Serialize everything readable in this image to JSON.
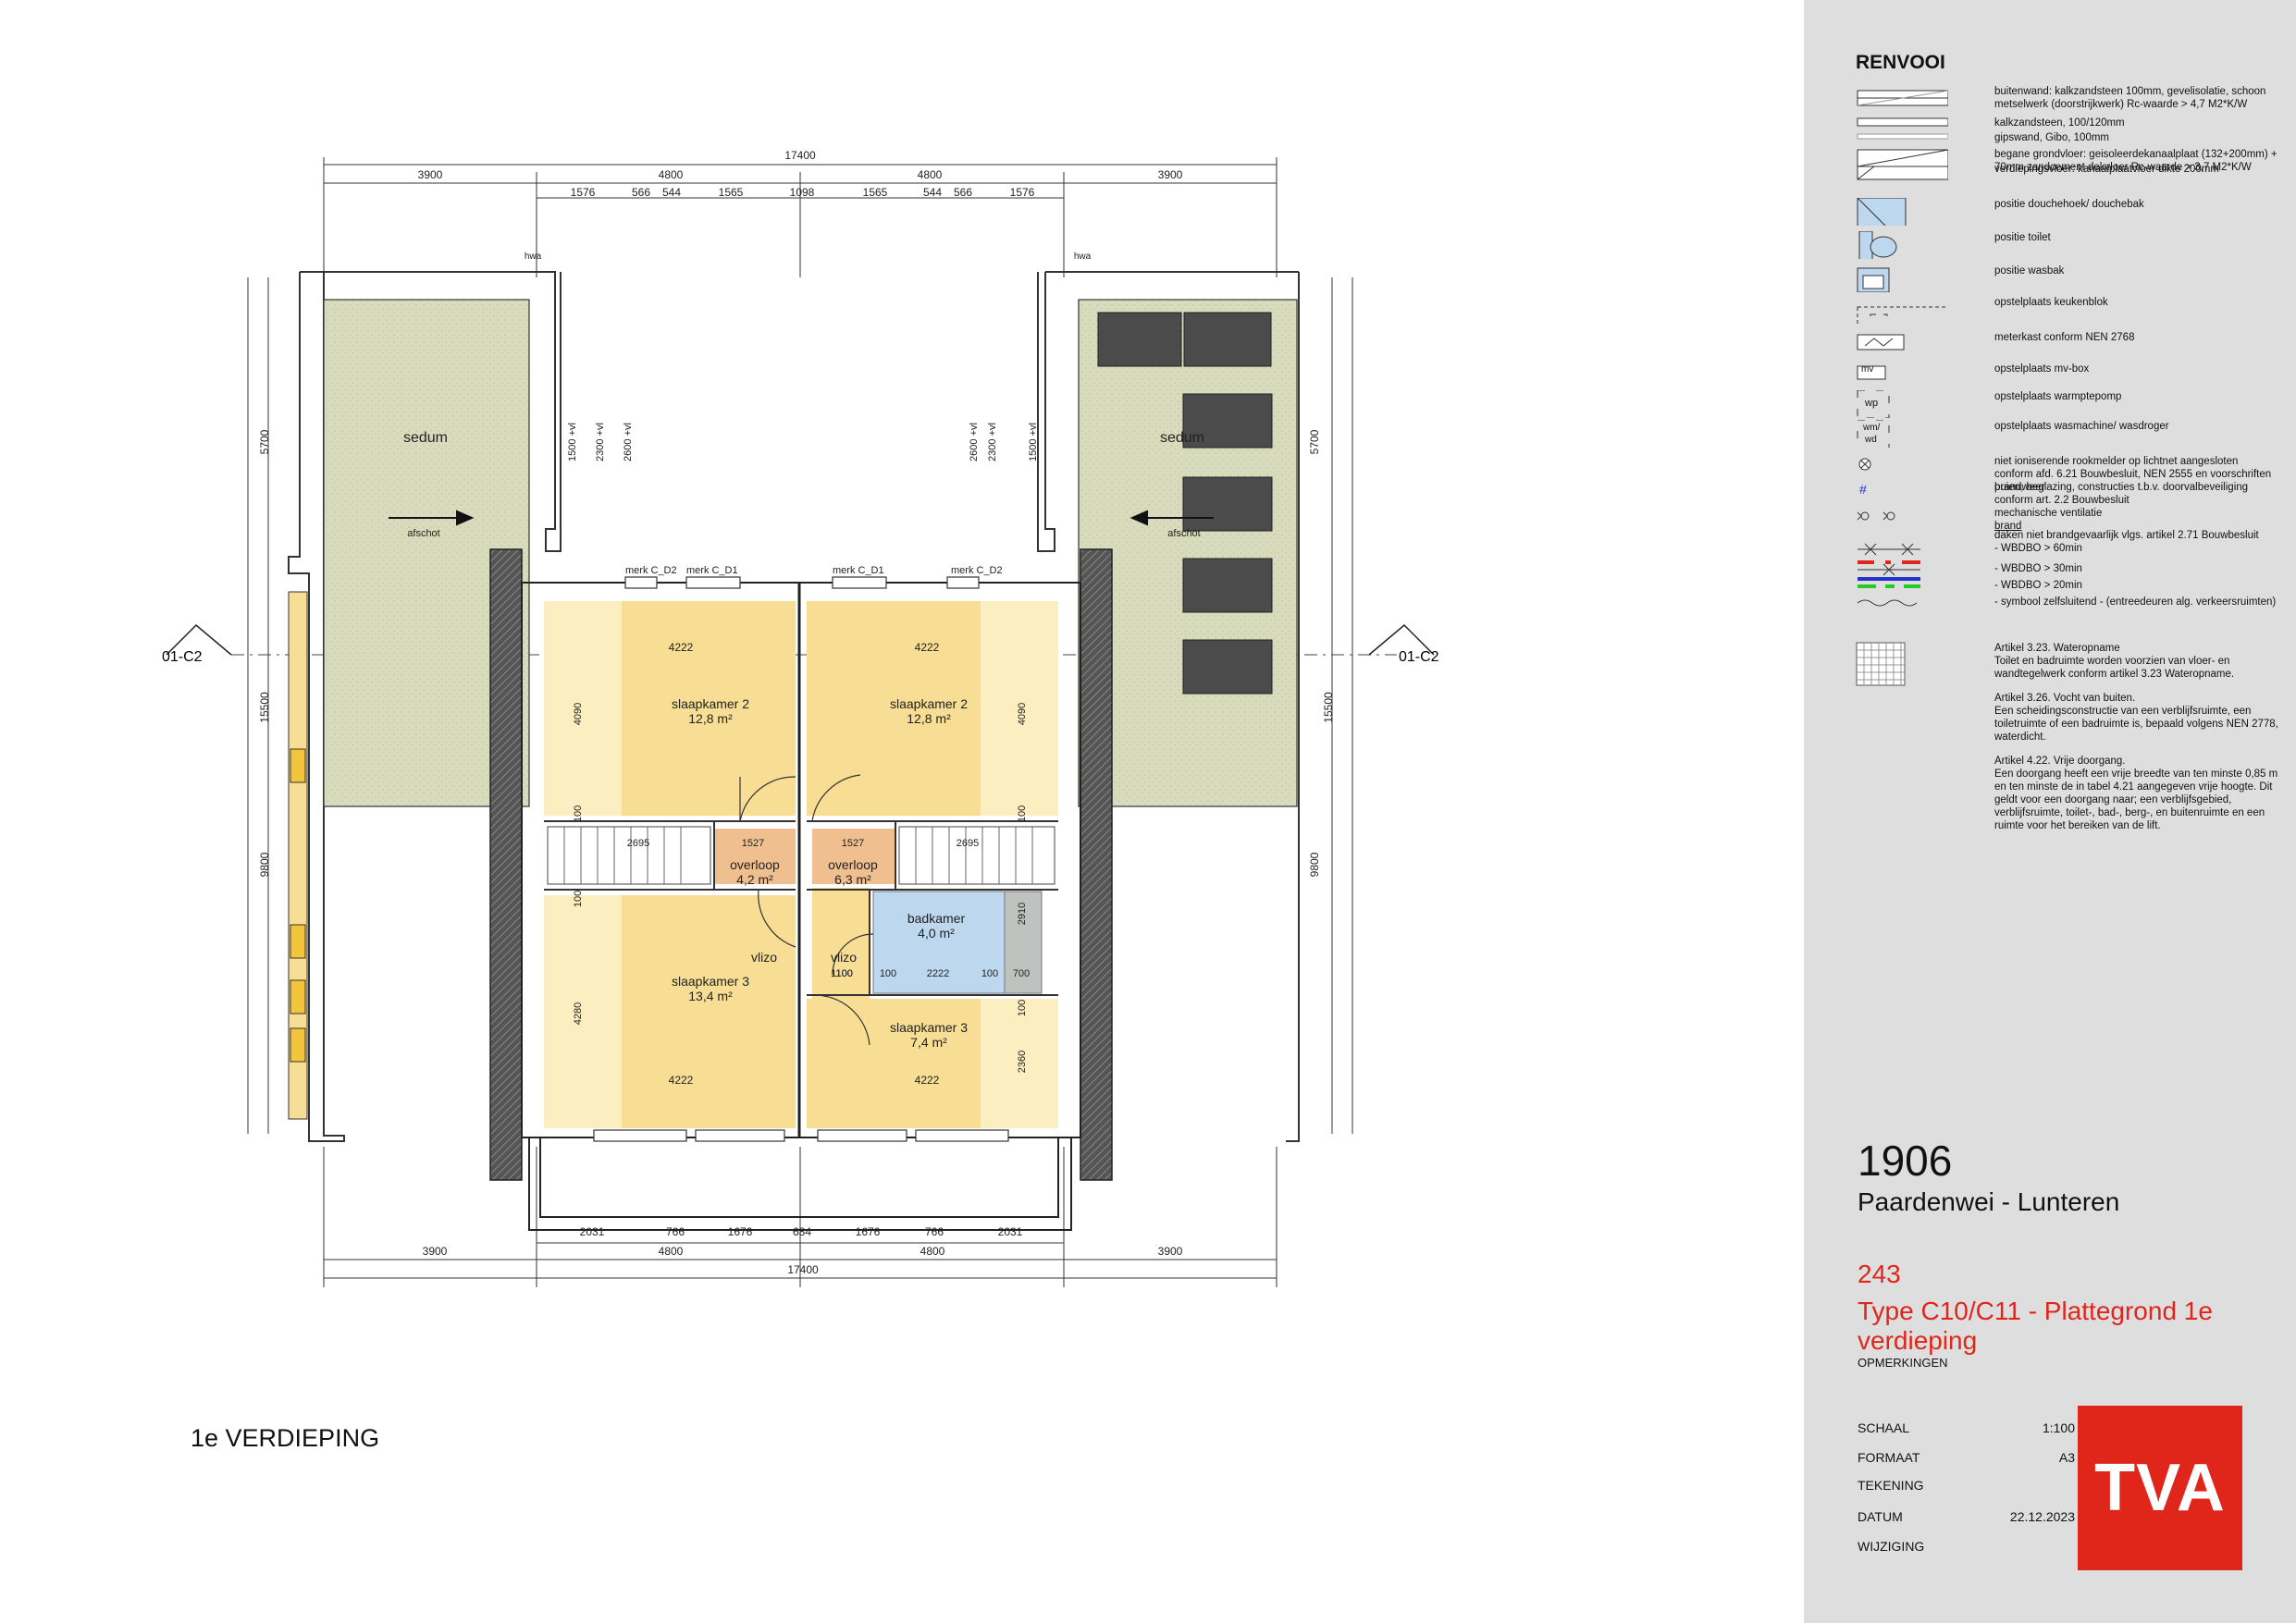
{
  "dimensions": {
    "top_total": "17400",
    "top_segments": [
      "3900",
      "4800",
      "4800",
      "3900"
    ],
    "top_details": [
      "1576",
      "566",
      "544",
      "1565",
      "1098",
      "1565",
      "544",
      "566",
      "1576"
    ],
    "bottom_details": [
      "2031",
      "766",
      "1676",
      "684",
      "1676",
      "766",
      "2031"
    ],
    "bottom_segments": [
      "3900",
      "4800",
      "4800",
      "3900"
    ],
    "bottom_total": "17400",
    "left_side": [
      "5700",
      "15500",
      "9800"
    ],
    "right_side": [
      "5700",
      "15500",
      "9800"
    ],
    "heights": [
      "1500 +vl",
      "2300 +vl",
      "2600 +vl"
    ],
    "heights_right": [
      "2600 +vl",
      "2300 +vl",
      "1500 +vl"
    ],
    "room_widths": [
      "4222",
      "4222",
      "4222",
      "4222"
    ],
    "interior": [
      "4090",
      "100",
      "2695",
      "1527",
      "100",
      "4280",
      "1527",
      "2695",
      "4090",
      "100",
      "2910",
      "1100",
      "100",
      "2222",
      "100",
      "700",
      "100",
      "2360",
      "1100"
    ]
  },
  "plan_labels": {
    "hwa_left": "hwa",
    "hwa_right": "hwa",
    "sedum_left": "sedum",
    "sedum_right": "sedum",
    "afschot_left": "afschot",
    "afschot_right": "afschot",
    "section_left": "01-C2",
    "section_right": "01-C2",
    "merk_labels": [
      "merk C_D2",
      "merk C_D1",
      "merk C_D1",
      "merk C_D2"
    ]
  },
  "rooms": [
    {
      "name": "slaapkamer 2",
      "area": "12,8 m²"
    },
    {
      "name": "slaapkamer 2",
      "area": "12,8 m²"
    },
    {
      "name": "overloop",
      "area": "4,2 m²"
    },
    {
      "name": "overloop",
      "area": "6,3 m²"
    },
    {
      "name": "badkamer",
      "area": "4,0 m²"
    },
    {
      "name": "slaapkamer 3",
      "area": "13,4 m²"
    },
    {
      "name": "slaapkamer 3",
      "area": "7,4 m²"
    },
    {
      "name": "vlizo"
    },
    {
      "name": "vlizo"
    }
  ],
  "floor_label": "1e VERDIEPING",
  "renvooi": {
    "title": "RENVOOI",
    "items": [
      {
        "symbol": "brick-wall-symbol",
        "text": "buitenwand: kalkzandsteen 100mm, gevelisolatie, schoon metselwerk (doorstrijkwerk) Rc-waarde > 4,7 M2*K/W"
      },
      {
        "symbol": "sandlime-wall-symbol",
        "text": "kalkzandsteen, 100/120mm"
      },
      {
        "symbol": "gypsum-wall-symbol",
        "text": "gipswand, Gibo, 100mm"
      },
      {
        "symbol": "ground-floor-symbol",
        "text": "begane grondvloer: geisoleerdekanaalplaat (132+200mm) + 70mm zandcement dekvloer Rc-waarde > 3,7 M2*K/W"
      },
      {
        "symbol": "upper-floor-symbol",
        "text": "verdiepingsvloer: kanaalplaatvloer dikte 200mm"
      },
      {
        "symbol": "shower-symbol",
        "text": "positie douchehoek/ douchebak"
      },
      {
        "symbol": "toilet-symbol",
        "text": "positie toilet"
      },
      {
        "symbol": "washbasin-symbol",
        "text": "positie wasbak"
      },
      {
        "symbol": "kitchen-symbol",
        "text": "opstelplaats keukenblok"
      },
      {
        "symbol": "meter-cupboard-symbol",
        "text": "meterkast conform NEN 2768"
      },
      {
        "symbol": "mv-box-symbol",
        "text": "opstelplaats mv-box"
      },
      {
        "symbol": "heat-pump-symbol",
        "text": "opstelplaats warmptepomp"
      },
      {
        "symbol": "washer-dryer-symbol",
        "text": "opstelplaats wasmachine/ wasdroger"
      },
      {
        "symbol": "smoke-detector-symbol",
        "text": "niet ioniserende rookmelder op lichtnet aangesloten conform afd. 6.21 Bouwbesluit, NEN 2555 en voorschriften brandweer"
      },
      {
        "symbol": "fall-protection-symbol",
        "text": "puien, beglazing, constructies t.b.v. doorvalbeveiliging conform art. 2.2 Bouwbesluit"
      },
      {
        "symbol": "ventilation-symbol",
        "text": "mechanische ventilatie"
      },
      {
        "symbol": "",
        "text": "brand"
      },
      {
        "symbol": "",
        "text": "daken niet brandgevaarlijk vlgs. artikel 2.71 Bouwbesluit"
      },
      {
        "symbol": "wbdbo-60-symbol",
        "text": "- WBDBO > 60min"
      },
      {
        "symbol": "wbdbo-30-symbol",
        "text": "- WBDBO > 30min"
      },
      {
        "symbol": "wbdbo-20-symbol",
        "text": "- WBDBO > 20min"
      },
      {
        "symbol": "self-closing-symbol",
        "text": "- symbool zelfsluitend - (entreedeuren alg. verkeersruimten)"
      }
    ],
    "symbol_labels": {
      "mv": "mv",
      "wp": "wp",
      "wm": "wm/",
      "wd": "wd",
      "hash": "#"
    },
    "articles": [
      {
        "title": "Artikel 3.23. Wateropname",
        "text": "Toilet en badruimte worden voorzien van vloer- en wandtegelwerk conform artikel 3.23 Wateropname."
      },
      {
        "title": "Artikel 3.26. Vocht van buiten.",
        "text": "Een scheidingsconstructie van een verblijfsruimte, een toiletruimte of een badruimte is, bepaald volgens NEN 2778, waterdicht."
      },
      {
        "title": "Artikel 4.22. Vrije doorgang.",
        "text": "Een doorgang heeft een vrije breedte van ten minste 0,85 m en ten minste de in tabel 4.21 aangegeven vrije hoogte. Dit geldt voor een doorgang naar; een verblijfsgebied, verblijfsruimte, toilet-, bad-, berg-, en buitenruimte en een ruimte voor het bereiken van de lift."
      }
    ]
  },
  "title_block": {
    "project_number": "1906",
    "project_name": "Paardenwei - Lunteren",
    "house_number": "243",
    "type_title": "Type C10/C11 - Plattegrond 1e verdieping",
    "remarks_label": "OPMERKINGEN",
    "scale_label": "SCHAAL",
    "scale_value": "1:100",
    "format_label": "FORMAAT",
    "format_value": "A3",
    "drawing_label": "TEKENING",
    "date_label": "DATUM",
    "date_value": "22.12.2023",
    "change_label": "WIJZIGING",
    "logo_text": "TVA"
  },
  "colors": {
    "bedroom_fill": "#f7de94",
    "bedroom_light": "#fbeec0",
    "landing_fill": "#f0bf8f",
    "bathroom_fill": "#bcd7ee",
    "sedum_fill": "#d8dcbd",
    "solar_panel": "#4b4b4b",
    "accent_red": "#e0261b"
  }
}
